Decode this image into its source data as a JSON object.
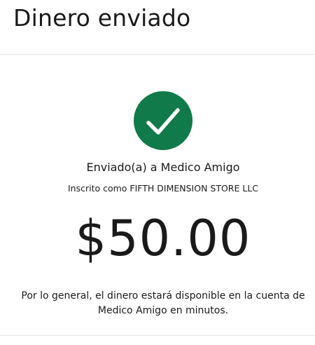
{
  "header": {
    "title": "Dinero enviado"
  },
  "confirmation": {
    "icon": "check-icon",
    "badge_color": "#117a4a",
    "recipient_text": "Enviado(a) a Medico Amigo",
    "registered_text": "Inscrito como FIFTH DIMENSION STORE LLC",
    "amount": "$50.00",
    "availability_note": "Por lo general, el dinero estará disponible en la cuenta de Medico Amigo en minutos."
  }
}
